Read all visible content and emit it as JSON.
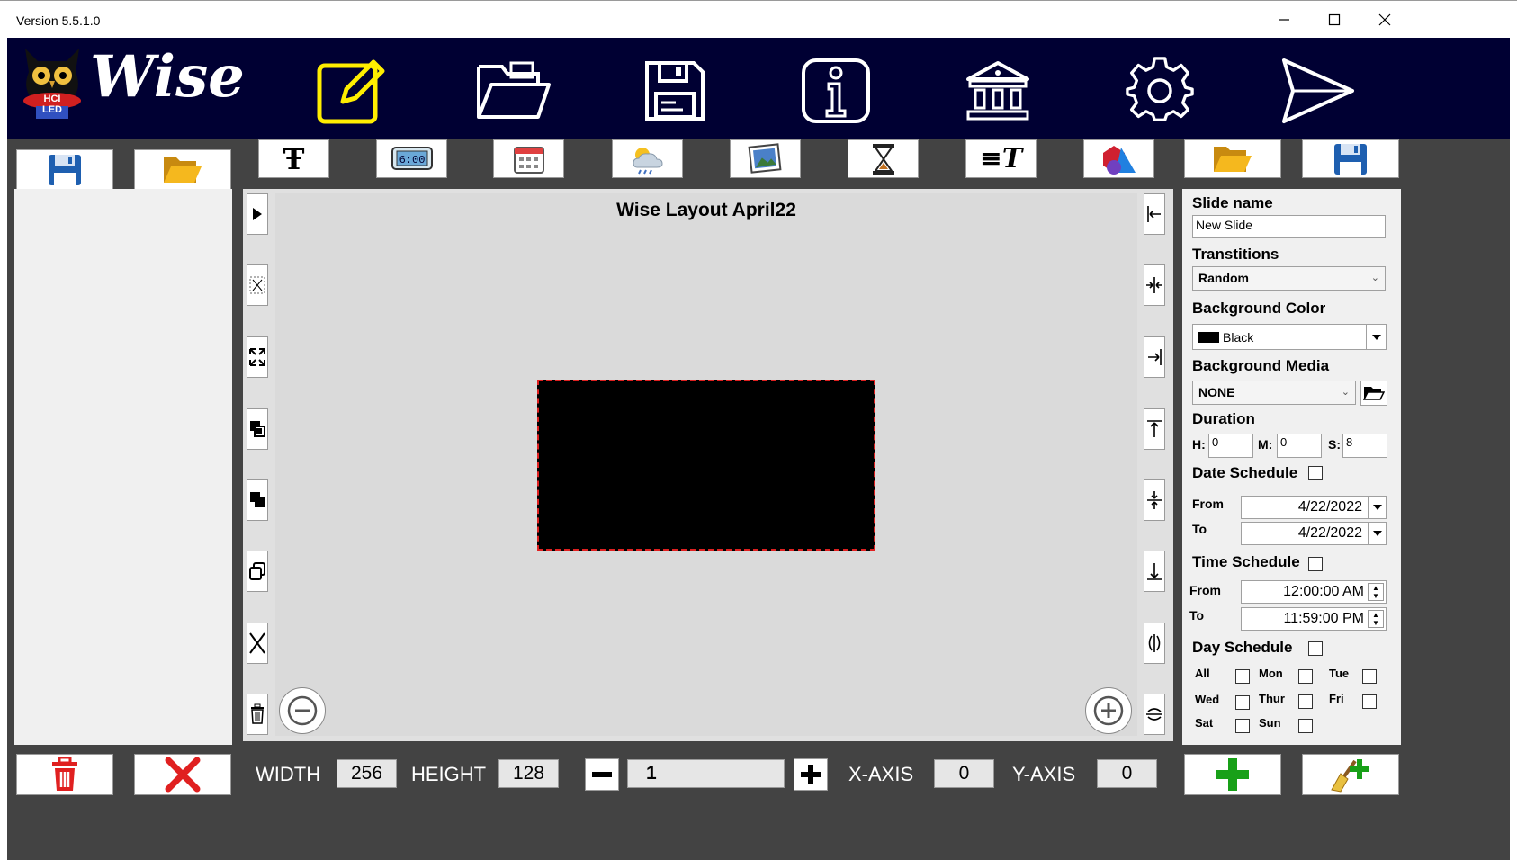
{
  "window": {
    "version": "Version 5.5.1.0"
  },
  "header": {
    "brand": "Wise",
    "logo_text": "HCI LED",
    "icons": [
      "edit-icon",
      "open-folder-icon",
      "save-icon",
      "info-icon",
      "library-icon",
      "settings-icon",
      "send-icon"
    ]
  },
  "left_panel": {
    "top_buttons": [
      "save-icon",
      "open-folder-icon"
    ],
    "bottom_buttons": [
      "trash-icon",
      "close-icon"
    ]
  },
  "toolbar": {
    "items": [
      "text-icon",
      "clock-icon",
      "calendar-icon",
      "weather-icon",
      "image-icon",
      "hourglass-icon",
      "scrolling-text-icon",
      "shapes-icon"
    ]
  },
  "canvas": {
    "title": "Wise Layout April22"
  },
  "left_tools": [
    "play-icon",
    "select-remove-icon",
    "resize-icon",
    "bring-forward-icon",
    "send-backward-icon",
    "duplicate-icon",
    "delete-x-icon",
    "trash-icon"
  ],
  "right_tools": [
    "align-left-icon",
    "align-center-h-icon",
    "align-right-icon",
    "align-top-icon",
    "align-middle-v-icon",
    "align-bottom-icon",
    "flip-h-icon",
    "flip-v-icon"
  ],
  "zoom": {
    "out": "zoom-out-icon",
    "in": "zoom-in-icon"
  },
  "slide": {
    "name_label": "Slide name",
    "name_value": "New Slide",
    "transitions_label": "Transtitions",
    "transitions_value": "Random",
    "bgcolor_label": "Background Color",
    "bgcolor_value": "Black",
    "bgcolor_hex": "#000000",
    "bgmedia_label": "Background Media",
    "bgmedia_value": "NONE",
    "duration_label": "Duration",
    "h_label": "H:",
    "h_value": "0",
    "m_label": "M:",
    "m_value": "0",
    "s_label": "S:",
    "s_value": "8",
    "date_schedule_label": "Date Schedule",
    "from_label": "From",
    "to_label": "To",
    "date_from": "4/22/2022",
    "date_to": "4/22/2022",
    "time_schedule_label": "Time Schedule",
    "time_from": "12:00:00 AM",
    "time_to": "11:59:00 PM",
    "day_schedule_label": "Day Schedule",
    "days": [
      "All",
      "Mon",
      "Tue",
      "Wed",
      "Thur",
      "Fri",
      "Sat",
      "Sun"
    ]
  },
  "right_top_buttons": [
    "open-folder-icon",
    "save-icon"
  ],
  "right_bottom_buttons": [
    "add-icon",
    "clear-icon"
  ],
  "bottom": {
    "width_label": "WIDTH",
    "width_value": "256",
    "height_label": "HEIGHT",
    "height_value": "128",
    "zoom_value": "1",
    "xaxis_label": "X-AXIS",
    "xaxis_value": "0",
    "yaxis_label": "Y-AXIS",
    "yaxis_value": "0"
  },
  "colors": {
    "header_bg": "#000033",
    "accent_yellow": "#ffee00",
    "red": "#e02020",
    "green": "#18a018",
    "selection": "#e02020"
  }
}
